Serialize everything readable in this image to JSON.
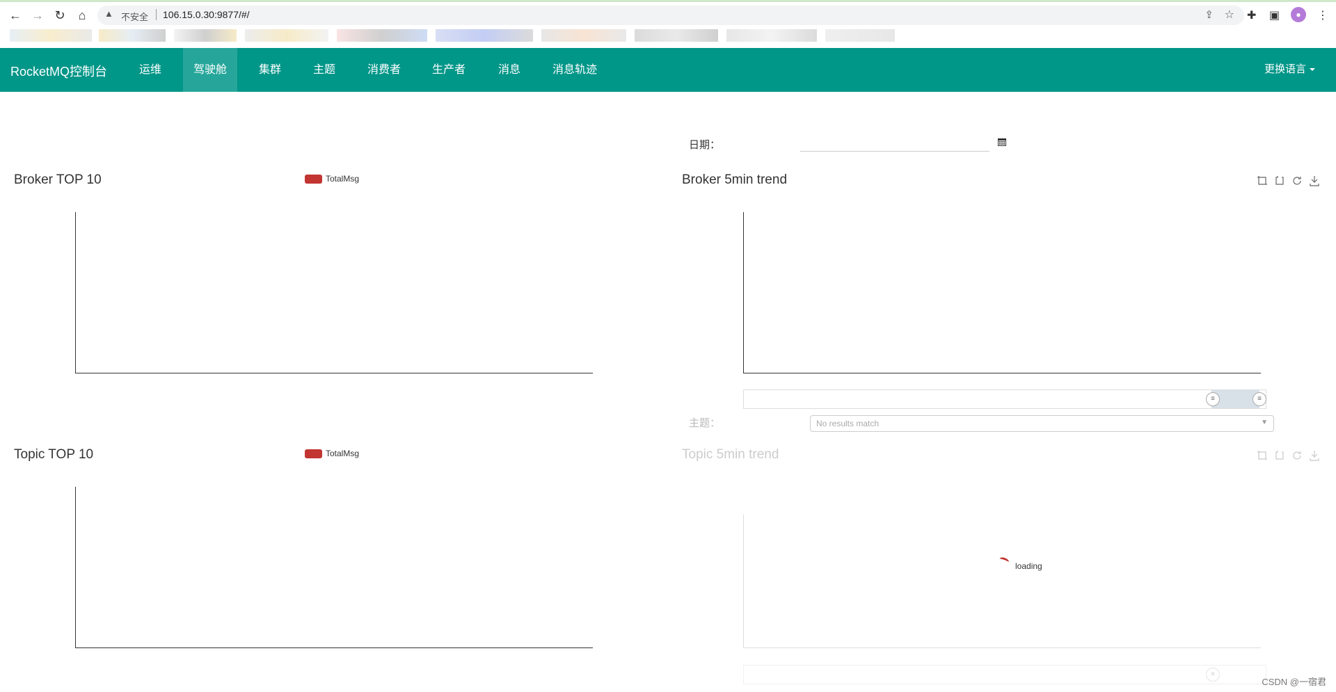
{
  "browser": {
    "security_text": "不安全",
    "url": "106.15.0.30:9877/#/"
  },
  "app": {
    "brand": "RocketMQ控制台",
    "menu": [
      {
        "label": "运维"
      },
      {
        "label": "驾驶舱"
      },
      {
        "label": "集群"
      },
      {
        "label": "主题"
      },
      {
        "label": "消费者"
      },
      {
        "label": "生产者"
      },
      {
        "label": "消息"
      },
      {
        "label": "消息轨迹"
      }
    ],
    "active_menu": "驾驶舱",
    "language": "更换语言"
  },
  "filters": {
    "date_label": "日期：",
    "date_value": "",
    "topic_label": "主题：",
    "topic_select": "No results match"
  },
  "panels": {
    "broker_top10": {
      "title": "Broker TOP 10",
      "legend": "TotalMsg"
    },
    "broker_trend": {
      "title": "Broker 5min trend"
    },
    "topic_top10": {
      "title": "Topic TOP 10",
      "legend": "TotalMsg"
    },
    "topic_trend": {
      "title": "Topic 5min trend",
      "loading": "loading"
    }
  },
  "colors": {
    "accent": "#009688",
    "active": "#26a69a",
    "series": "#c23531"
  },
  "watermark": "CSDN @一宿君",
  "chart_data": [
    {
      "type": "bar",
      "title": "Broker TOP 10",
      "legend": [
        "TotalMsg"
      ],
      "categories": [],
      "series": [
        {
          "name": "TotalMsg",
          "values": []
        }
      ]
    },
    {
      "type": "line",
      "title": "Broker 5min trend",
      "x": [],
      "series": []
    },
    {
      "type": "bar",
      "title": "Topic TOP 10",
      "legend": [
        "TotalMsg"
      ],
      "categories": [],
      "series": [
        {
          "name": "TotalMsg",
          "values": []
        }
      ]
    },
    {
      "type": "line",
      "title": "Topic 5min trend",
      "x": [],
      "series": []
    }
  ]
}
